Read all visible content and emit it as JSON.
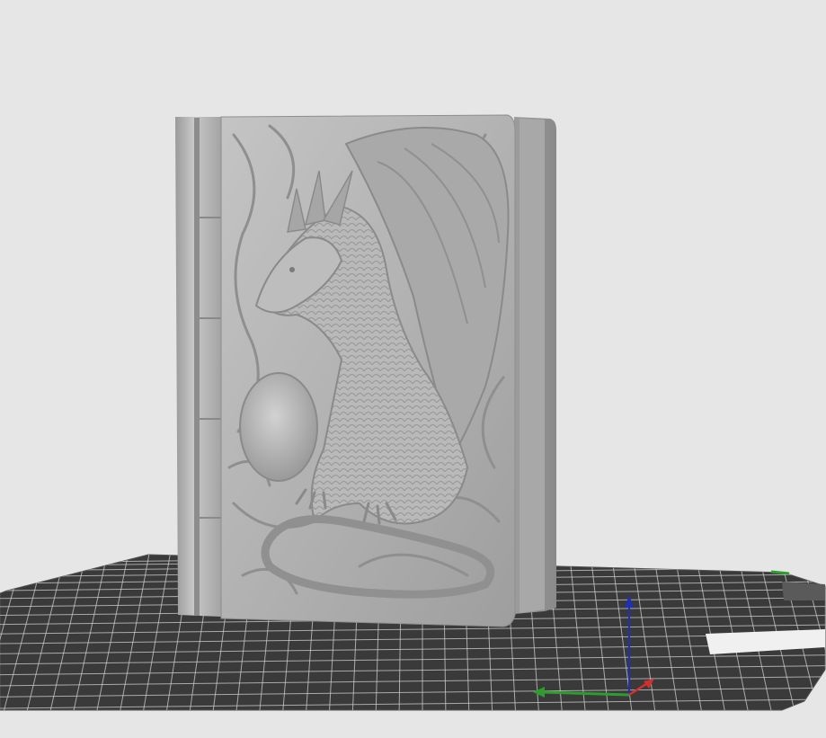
{
  "viewport": {
    "background_color": "#e6e6e6",
    "model": {
      "name": "dragon-book-box",
      "material_color": "#b4b4b4",
      "relief_subject": "dragon with egg"
    },
    "build_plate": {
      "color": "#3a3a3a",
      "grid_color": "#d0d0d0"
    },
    "axes": {
      "x_color": "#d32f2f",
      "y_color": "#2e9d2e",
      "z_color": "#1f2fb8"
    },
    "icons": [
      "axis-gizmo-icon",
      "view-cube-icon"
    ]
  }
}
